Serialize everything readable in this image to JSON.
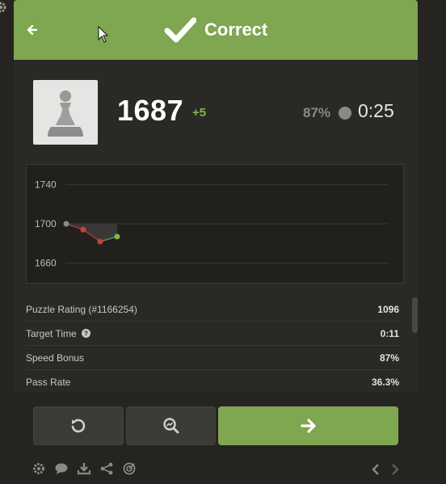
{
  "header": {
    "status_label": "Correct",
    "color": "#7fa650"
  },
  "player": {
    "avatar_icon": "pawn-icon",
    "rating": "1687",
    "rating_delta": "+5",
    "accuracy": "87%",
    "timer": "0:25"
  },
  "chart_data": {
    "type": "line",
    "y_ticks": [
      "1740",
      "1700",
      "1660"
    ],
    "ylim": [
      1640,
      1760
    ],
    "grid": true,
    "x": [
      1,
      2,
      3,
      4
    ],
    "values": [
      1700,
      1694,
      1682,
      1687
    ],
    "point_colors": [
      "#8b8987",
      "#c94040",
      "#c94040",
      "#81b64c"
    ]
  },
  "stats": [
    {
      "label": "Puzzle Rating (#1166254)",
      "value": "1096",
      "info": false
    },
    {
      "label": "Target Time",
      "value": "0:11",
      "info": true
    },
    {
      "label": "Speed Bonus",
      "value": "87%",
      "info": false
    },
    {
      "label": "Pass Rate",
      "value": "36.3%",
      "info": false
    }
  ],
  "buttons": {
    "retry_icon": "retry-icon",
    "analyze_icon": "analysis-icon",
    "next_icon": "arrow-right-icon"
  },
  "footer": {
    "icons": [
      "gear-icon",
      "chat-icon",
      "download-icon",
      "share-icon",
      "target-icon"
    ],
    "nav": [
      "chevron-left-icon",
      "chevron-right-icon"
    ]
  }
}
